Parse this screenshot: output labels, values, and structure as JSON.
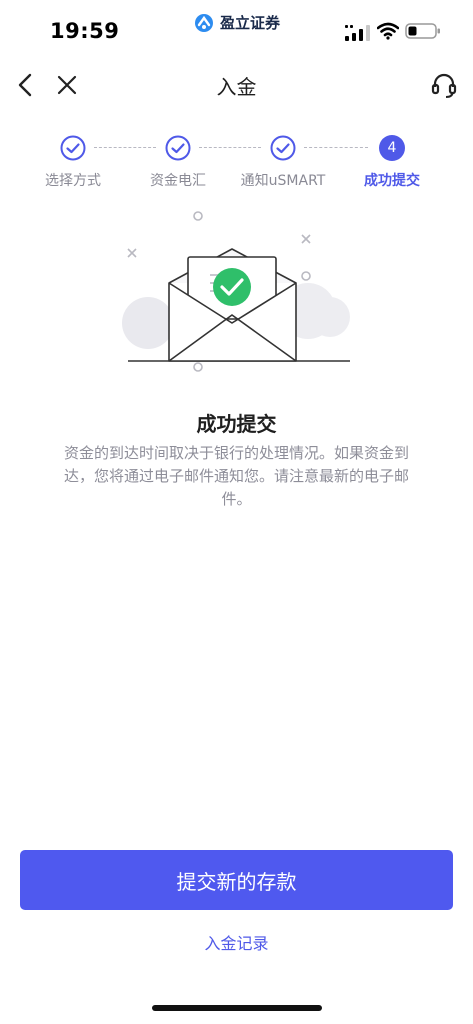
{
  "status_bar": {
    "time": "19:59",
    "carrier": "盈立证券"
  },
  "nav": {
    "title": "入金",
    "back_icon": "chevron-left-icon",
    "close_icon": "close-icon",
    "support_icon": "headset-icon"
  },
  "steps": [
    {
      "label": "选择方式",
      "state": "done"
    },
    {
      "label": "资金电汇",
      "state": "done"
    },
    {
      "label": "通知uSMART",
      "state": "done"
    },
    {
      "label": "成功提交",
      "number": "4",
      "state": "current"
    }
  ],
  "result": {
    "title": "成功提交",
    "description": "资金的到达时间取决于银行的处理情况。如果资金到达，您将通过电子邮件通知您。请注意最新的电子邮件。"
  },
  "actions": {
    "primary_label": "提交新的存款",
    "link_label": "入金记录"
  },
  "colors": {
    "accent": "#4f59ef",
    "success": "#2fbf6a",
    "muted_text": "#8e8e99"
  }
}
